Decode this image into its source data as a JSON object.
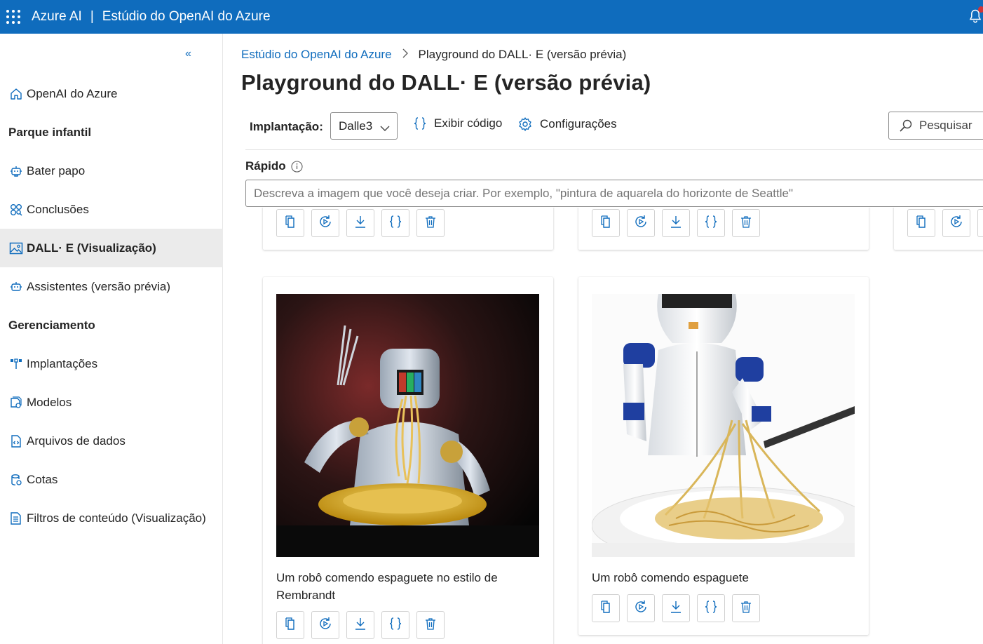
{
  "topbar": {
    "brand": "Azure AI",
    "separator": "|",
    "product": "Estúdio do OpenAI do Azure"
  },
  "sidebar": {
    "collapse_icon": "«",
    "items": [
      {
        "label": "OpenAI do Azure",
        "icon": "home-icon"
      },
      {
        "label": "Bater papo",
        "icon": "chat-bot-icon"
      },
      {
        "label": "Conclusões",
        "icon": "completions-icon"
      },
      {
        "label": "DALL· E (Visualização)",
        "icon": "image-icon",
        "active": true
      },
      {
        "label": "Assistentes (versão prévia)",
        "icon": "assistant-icon"
      },
      {
        "label": "Implantações",
        "icon": "deployments-icon"
      },
      {
        "label": "Modelos",
        "icon": "models-icon"
      },
      {
        "label": "Arquivos de dados",
        "icon": "data-files-icon"
      },
      {
        "label": "Cotas",
        "icon": "quotas-icon"
      },
      {
        "label": "Filtros de conteúdo (Visualização)",
        "icon": "content-filter-icon"
      }
    ],
    "sections": {
      "playground": "Parque infantil",
      "management": "Gerenciamento"
    }
  },
  "breadcrumb": {
    "parent": "Estúdio do OpenAI do Azure",
    "current": "Playground do DALL· E (versão prévia)"
  },
  "page_title": "Playground do DALL· E (versão prévia)",
  "toolbar": {
    "deployment_label": "Implantação:",
    "deployment_value": "Dalle3",
    "view_code": "Exibir código",
    "settings": "Configurações",
    "search": "Pesquisar"
  },
  "prompt": {
    "label": "Rápido",
    "placeholder": "Descreva a imagem que você deseja criar. Por exemplo, \"pintura de aquarela do horizonte de Seattle\""
  },
  "gallery": {
    "cards": [
      {
        "caption": "Um robô comendo espaguete no estilo de Rembrandt",
        "image": "robot-eating-spaghetti-rembrandt"
      },
      {
        "caption": "Um robô comendo espaguete",
        "image": "robot-eating-spaghetti"
      }
    ],
    "action_icons": [
      "copy-icon",
      "regenerate-icon",
      "download-icon",
      "json-icon",
      "delete-icon"
    ]
  },
  "colors": {
    "accent": "#0f6cbd",
    "topbar": "#0f6cbd",
    "active_nav": "#ebebeb",
    "notification": "#d13438"
  }
}
